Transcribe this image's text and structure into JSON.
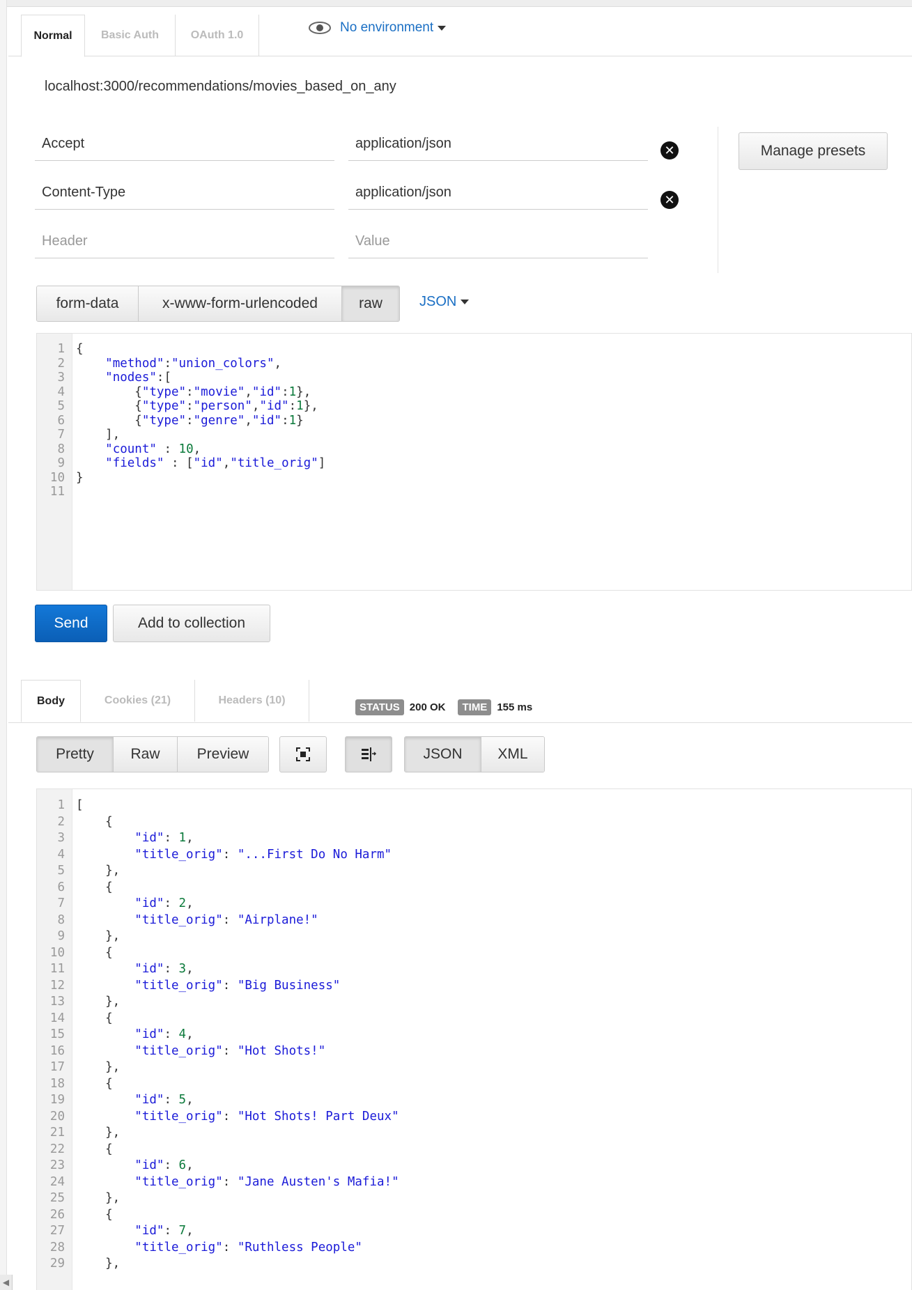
{
  "request": {
    "tabs": [
      {
        "label": "Normal",
        "active": true
      },
      {
        "label": "Basic Auth",
        "active": false
      },
      {
        "label": "OAuth 1.0",
        "active": false
      }
    ],
    "environment": "No environment",
    "url": "localhost:3000/recommendations/movies_based_on_any",
    "headers": [
      {
        "key": "Accept",
        "value": "application/json"
      },
      {
        "key": "Content-Type",
        "value": "application/json"
      }
    ],
    "header_placeholder_key": "Header",
    "header_placeholder_value": "Value",
    "manage_presets": "Manage presets",
    "body_modes": [
      "form-data",
      "x-www-form-urlencoded",
      "raw"
    ],
    "body_format": "JSON",
    "body_lines": [
      [
        {
          "t": "p",
          "v": "{"
        }
      ],
      [
        {
          "t": "p",
          "v": "    "
        },
        {
          "t": "k",
          "v": "\"method\""
        },
        {
          "t": "p",
          "v": ":"
        },
        {
          "t": "s",
          "v": "\"union_colors\""
        },
        {
          "t": "p",
          "v": ","
        }
      ],
      [
        {
          "t": "p",
          "v": "    "
        },
        {
          "t": "k",
          "v": "\"nodes\""
        },
        {
          "t": "p",
          "v": ":["
        }
      ],
      [
        {
          "t": "p",
          "v": "        {"
        },
        {
          "t": "k",
          "v": "\"type\""
        },
        {
          "t": "p",
          "v": ":"
        },
        {
          "t": "s",
          "v": "\"movie\""
        },
        {
          "t": "p",
          "v": ","
        },
        {
          "t": "k",
          "v": "\"id\""
        },
        {
          "t": "p",
          "v": ":"
        },
        {
          "t": "n",
          "v": "1"
        },
        {
          "t": "p",
          "v": "},"
        }
      ],
      [
        {
          "t": "p",
          "v": "        {"
        },
        {
          "t": "k",
          "v": "\"type\""
        },
        {
          "t": "p",
          "v": ":"
        },
        {
          "t": "s",
          "v": "\"person\""
        },
        {
          "t": "p",
          "v": ","
        },
        {
          "t": "k",
          "v": "\"id\""
        },
        {
          "t": "p",
          "v": ":"
        },
        {
          "t": "n",
          "v": "1"
        },
        {
          "t": "p",
          "v": "},"
        }
      ],
      [
        {
          "t": "p",
          "v": "        {"
        },
        {
          "t": "k",
          "v": "\"type\""
        },
        {
          "t": "p",
          "v": ":"
        },
        {
          "t": "s",
          "v": "\"genre\""
        },
        {
          "t": "p",
          "v": ","
        },
        {
          "t": "k",
          "v": "\"id\""
        },
        {
          "t": "p",
          "v": ":"
        },
        {
          "t": "n",
          "v": "1"
        },
        {
          "t": "p",
          "v": "}"
        }
      ],
      [
        {
          "t": "p",
          "v": "    ],"
        }
      ],
      [
        {
          "t": "p",
          "v": "    "
        },
        {
          "t": "k",
          "v": "\"count\""
        },
        {
          "t": "p",
          "v": " : "
        },
        {
          "t": "n",
          "v": "10"
        },
        {
          "t": "p",
          "v": ","
        }
      ],
      [
        {
          "t": "p",
          "v": "    "
        },
        {
          "t": "k",
          "v": "\"fields\""
        },
        {
          "t": "p",
          "v": " : ["
        },
        {
          "t": "s",
          "v": "\"id\""
        },
        {
          "t": "p",
          "v": ","
        },
        {
          "t": "s",
          "v": "\"title_orig\""
        },
        {
          "t": "p",
          "v": "]"
        }
      ],
      [
        {
          "t": "p",
          "v": "}"
        }
      ],
      [
        {
          "t": "p",
          "v": ""
        }
      ]
    ],
    "send": "Send",
    "add_to_collection": "Add to collection"
  },
  "response": {
    "tabs": [
      {
        "label": "Body",
        "active": true
      },
      {
        "label": "Cookies (21)",
        "active": false
      },
      {
        "label": "Headers (10)",
        "active": false
      }
    ],
    "status_label": "STATUS",
    "status_value": "200 OK",
    "time_label": "TIME",
    "time_value": "155 ms",
    "view_modes": [
      "Pretty",
      "Raw",
      "Preview"
    ],
    "formats": [
      "JSON",
      "XML"
    ],
    "items": [
      {
        "id": 1,
        "title": "...First Do No Harm"
      },
      {
        "id": 2,
        "title": "Airplane!"
      },
      {
        "id": 3,
        "title": "Big Business"
      },
      {
        "id": 4,
        "title": "Hot Shots!"
      },
      {
        "id": 5,
        "title": "Hot Shots! Part Deux"
      },
      {
        "id": 6,
        "title": "Jane Austen's Mafia!"
      },
      {
        "id": 7,
        "title": "Ruthless People"
      }
    ]
  },
  "colors": {
    "accent_blue": "#1a6fc4",
    "send_blue": "#0b5fb6",
    "json_key": "#1b1bd8",
    "json_number": "#0b7a3b"
  }
}
